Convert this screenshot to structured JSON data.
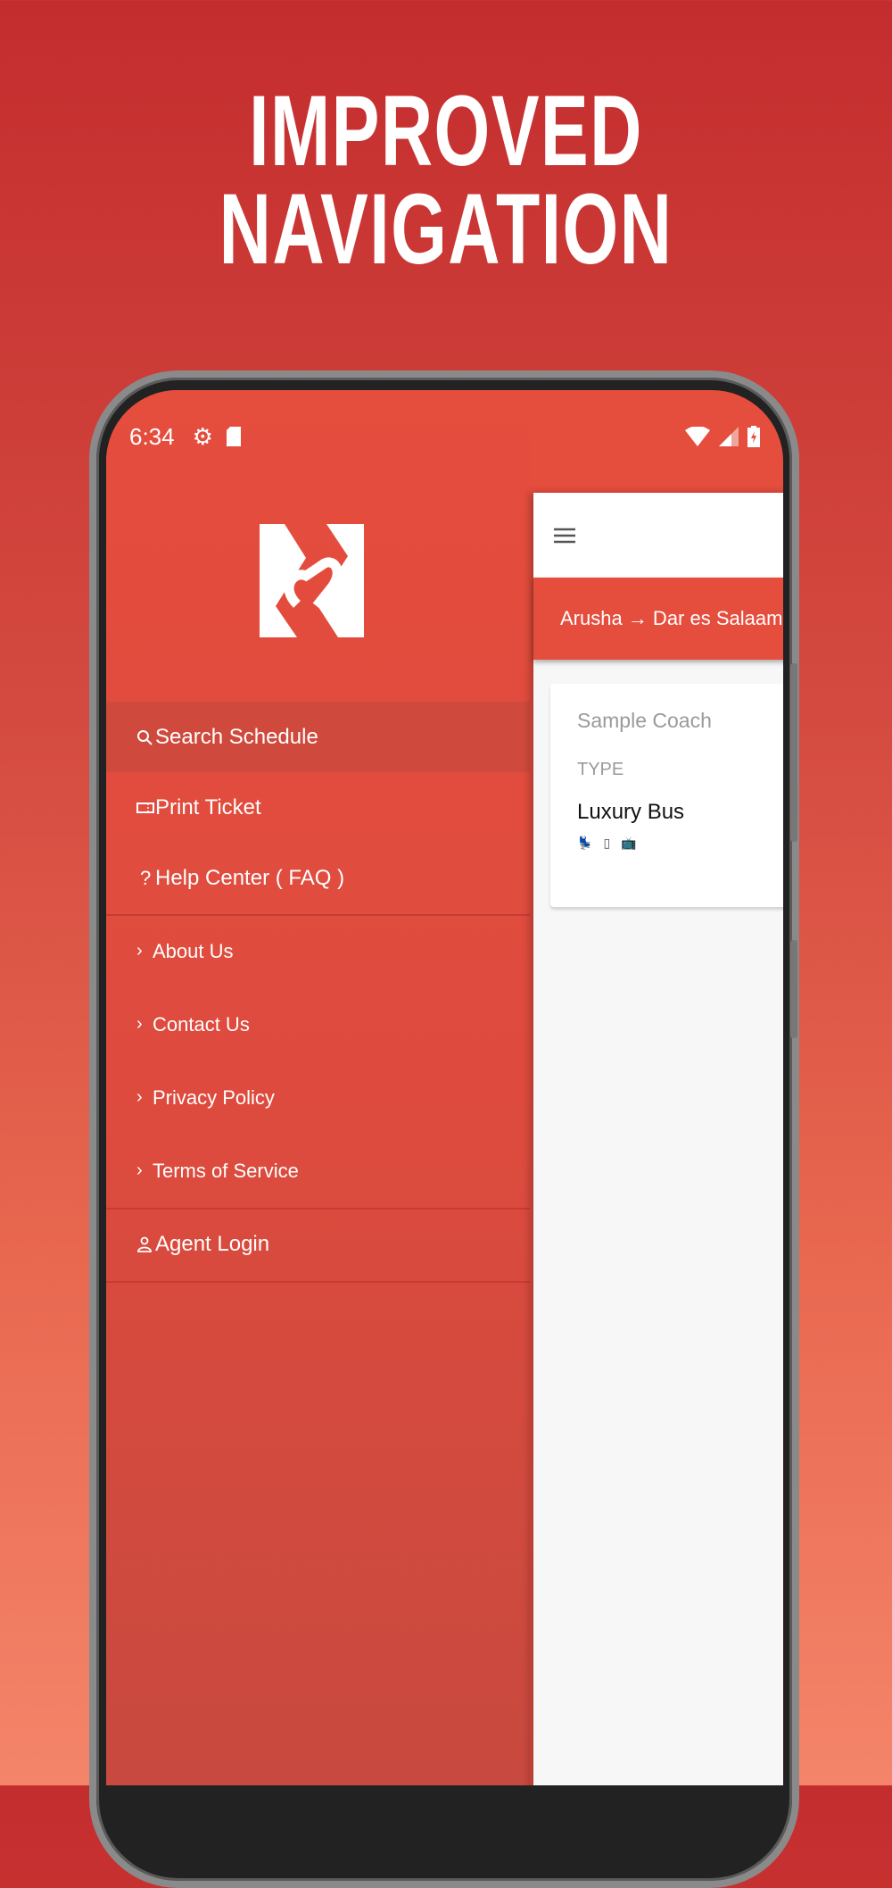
{
  "headline": "IMPROVED NAVIGATION",
  "status_bar": {
    "time": "6:34",
    "icons": [
      "settings-icon",
      "sd-card-icon",
      "wifi-icon",
      "signal-icon",
      "battery-charging-icon"
    ]
  },
  "drawer": {
    "primary": [
      {
        "label": "Search Schedule",
        "icon": "search-icon",
        "selected": true
      },
      {
        "label": "Print Ticket",
        "icon": "ticket-icon"
      },
      {
        "label": "Help Center ( FAQ )",
        "icon": "question-icon"
      }
    ],
    "secondary": [
      {
        "label": "About Us",
        "icon": "chevron-right-icon"
      },
      {
        "label": "Contact Us",
        "icon": "chevron-right-icon"
      },
      {
        "label": "Privacy Policy",
        "icon": "chevron-right-icon"
      },
      {
        "label": "Terms of Service",
        "icon": "chevron-right-icon"
      }
    ],
    "account": [
      {
        "label": "Agent Login",
        "icon": "user-icon"
      }
    ]
  },
  "main": {
    "route": "Arusha → Dar es Salaam",
    "card": {
      "name": "Sample Coach",
      "type_label": "TYPE",
      "type_value": "Luxury Bus",
      "amenities": [
        "seat-icon",
        "charging-icon",
        "tv-icon"
      ]
    }
  },
  "colors": {
    "brand": "#e54d3d",
    "text_muted": "#9a9a9a"
  }
}
